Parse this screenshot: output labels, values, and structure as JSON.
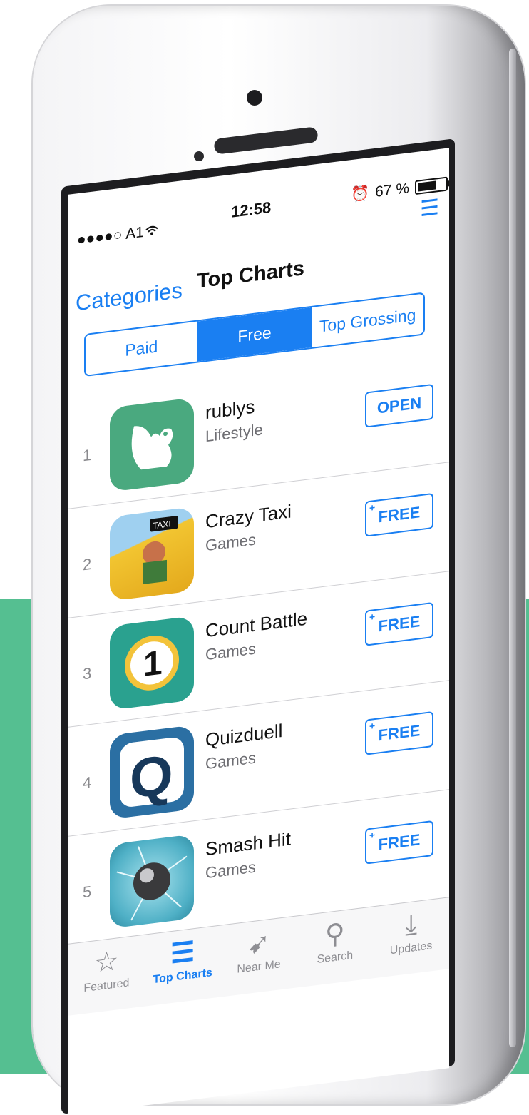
{
  "status_bar": {
    "carrier": "●●●●○ A1",
    "wifi_icon": "wifi-icon",
    "time": "12:58",
    "battery_label": "67 %",
    "alarm_icon": "alarm-icon"
  },
  "nav": {
    "back_label": "Categories",
    "title": "Top Charts",
    "list_icon": "list-icon"
  },
  "segments": [
    {
      "label": "Paid",
      "active": false
    },
    {
      "label": "Free",
      "active": true
    },
    {
      "label": "Top Grossing",
      "active": false
    }
  ],
  "apps": [
    {
      "rank": "1",
      "name": "rublys",
      "category": "Lifestyle",
      "action": "OPEN",
      "action_plus": "",
      "icon": "rublys-squirrel-icon",
      "icon_color": "#4aa97f"
    },
    {
      "rank": "2",
      "name": "Crazy Taxi",
      "category": "Games",
      "action": "FREE",
      "action_plus": "+",
      "icon": "crazy-taxi-icon",
      "icon_color": "#f2c531"
    },
    {
      "rank": "3",
      "name": "Count Battle",
      "category": "Games",
      "action": "FREE",
      "action_plus": "+",
      "icon": "count-battle-icon",
      "icon_color": "#2aa18f"
    },
    {
      "rank": "4",
      "name": "Quizduell",
      "category": "Games",
      "action": "FREE",
      "action_plus": "+",
      "icon": "quizduell-icon",
      "icon_color": "#2b6fa3"
    },
    {
      "rank": "5",
      "name": "Smash Hit",
      "category": "Games",
      "action": "FREE",
      "action_plus": "+",
      "icon": "smash-hit-icon",
      "icon_color": "#5bb6c9"
    }
  ],
  "tabs": [
    {
      "label": "Featured",
      "icon": "star-icon",
      "active": false
    },
    {
      "label": "Top Charts",
      "icon": "list-icon",
      "active": true
    },
    {
      "label": "Near Me",
      "icon": "location-arrow-icon",
      "active": false
    },
    {
      "label": "Search",
      "icon": "search-icon",
      "active": false
    },
    {
      "label": "Updates",
      "icon": "download-tray-icon",
      "active": false
    }
  ],
  "colors": {
    "accent": "#1a7ff2",
    "backdrop": "#55bf91"
  }
}
